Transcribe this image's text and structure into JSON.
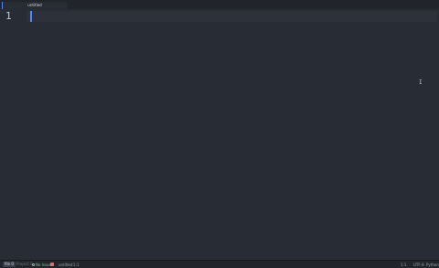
{
  "tabs": [
    {
      "label": "untitled",
      "active": true
    }
  ],
  "editor": {
    "line_numbers": [
      "1"
    ],
    "mouse_pointer": "I",
    "colors": {
      "background": "#282c34",
      "active_line": "#2c313a",
      "cursor": "#528bff",
      "gutter_text": "#c5cad3"
    }
  },
  "statusbar": {
    "file_button": "file 0",
    "project_button": "Project 0",
    "git_icon": "git-branch-icon",
    "git_label": "No Issues",
    "file_name": "untitled",
    "selection": "1:1",
    "cursor_position": "1:1",
    "encoding": "UTF-8",
    "grammar": "Python",
    "colors": {
      "git": "#73c990",
      "badge": "#e06c75",
      "background": "#21252b"
    }
  }
}
